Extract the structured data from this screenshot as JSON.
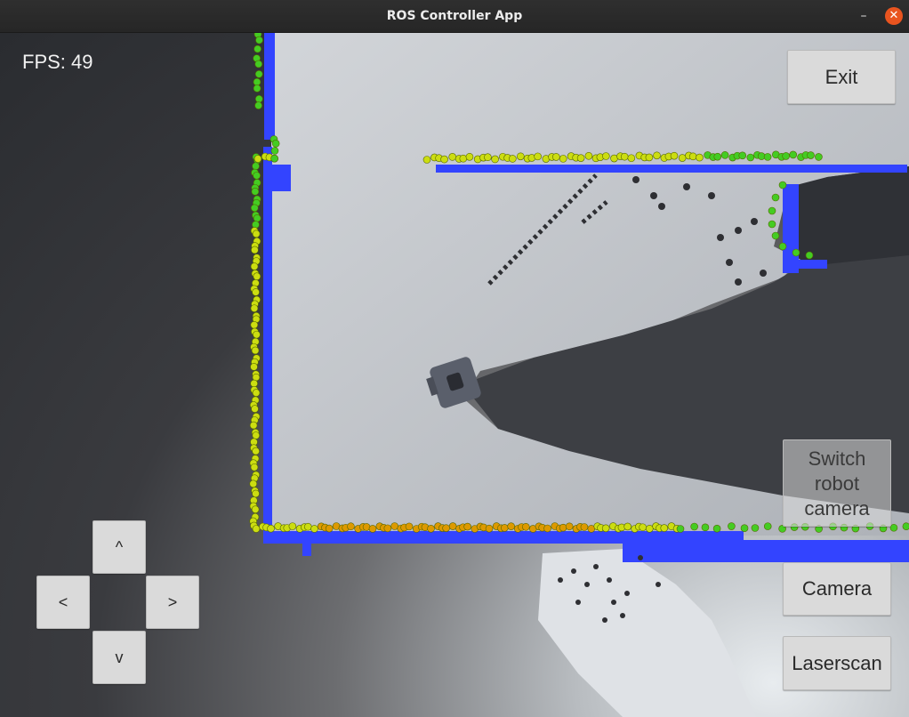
{
  "window": {
    "title": "ROS Controller App",
    "minimize_glyph": "–",
    "close_glyph": "✕",
    "close_color": "#e9541f"
  },
  "hud": {
    "fps_label": "FPS: 49"
  },
  "buttons": {
    "exit": "Exit",
    "switch_camera_line1": "Switch",
    "switch_camera_line2": "robot",
    "switch_camera_line3": "camera",
    "camera": "Camera",
    "laserscan": "Laserscan"
  },
  "dpad": {
    "up": "^",
    "left": "<",
    "right": ">",
    "down": "v"
  },
  "colors": {
    "map_free": "#c9ccd0",
    "map_wall": "#3344ff",
    "laser_near": "#44cc22",
    "laser_mid": "#ccdd11",
    "laser_far": "#dd9900",
    "robot": "#5a5f6b"
  }
}
